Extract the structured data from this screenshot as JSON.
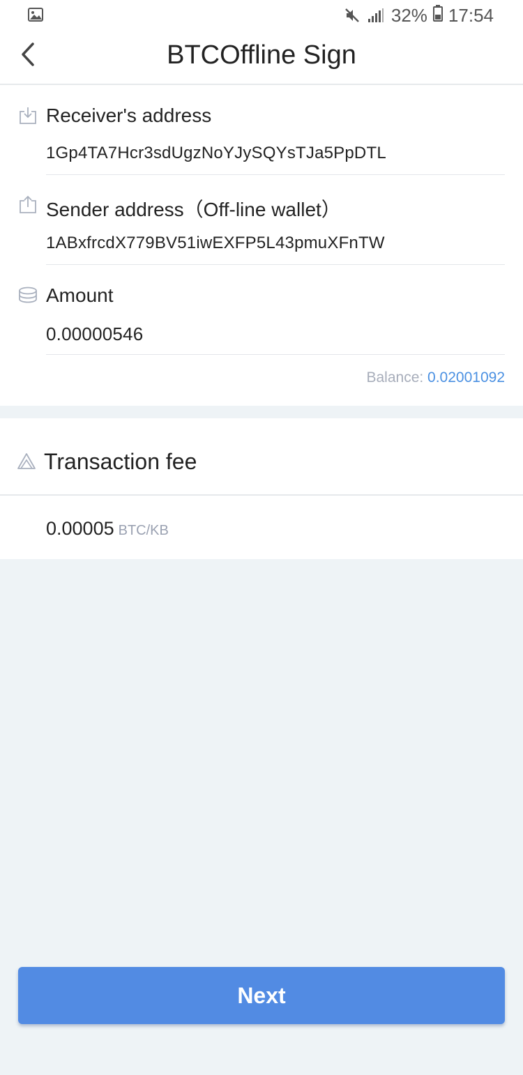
{
  "status_bar": {
    "battery_percent": "32%",
    "time": "17:54",
    "icons": [
      "gallery-icon",
      "mute-icon",
      "signal-icon",
      "battery-icon"
    ]
  },
  "nav": {
    "title": "BTCOffline Sign",
    "back_icon": "chevron-left-icon"
  },
  "form": {
    "receiver": {
      "label": "Receiver's address",
      "value": "1Gp4TA7Hcr3sdUgzNoYJySQYsTJa5PpDTL",
      "icon": "download-icon"
    },
    "sender": {
      "label": "Sender address（Off-line wallet）",
      "value": "1ABxfrcdX779BV51iwEXFP5L43pmuXFnTW",
      "icon": "upload-icon"
    },
    "amount": {
      "label": "Amount",
      "value": "0.00000546",
      "icon": "coins-icon"
    },
    "balance": {
      "label": "Balance: ",
      "value": "0.02001092"
    }
  },
  "fee": {
    "title": "Transaction fee",
    "value": "0.00005",
    "unit": "BTC/KB",
    "icon": "fee-triangle-icon"
  },
  "actions": {
    "next_label": "Next"
  },
  "colors": {
    "accent": "#528be3",
    "link": "#4a90e2",
    "background": "#eef3f6",
    "muted": "#a7adba"
  }
}
